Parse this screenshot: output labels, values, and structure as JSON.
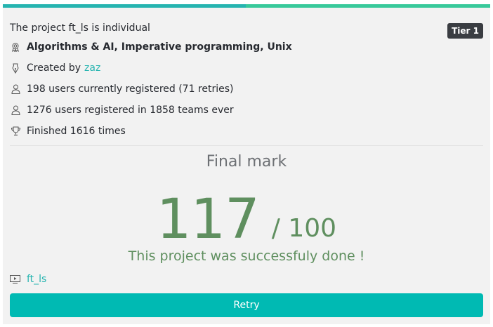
{
  "project": {
    "title": "The project ft_ls is individual",
    "tier": "Tier 1",
    "domains": "Algorithms & AI, Imperative programming, Unix",
    "created_by_label": "Created by",
    "creator": "zaz",
    "current_registrations": "198 users currently registered (71 retries)",
    "total_registrations": "1276 users registered in 1858 teams ever",
    "finished": "Finished 1616 times"
  },
  "result": {
    "final_mark_label": "Final mark",
    "mark": "117",
    "max": "/ 100",
    "status": "This project was successfuly done !"
  },
  "repository": {
    "name": "ft_ls"
  },
  "actions": {
    "retry_label": "Retry"
  },
  "colors": {
    "accent": "#00bab3",
    "progress_left": "#26b4b0",
    "progress_right": "#38c99a",
    "success": "#5f8f5f",
    "badge": "#3a3d42",
    "card_bg": "#f2f2f2"
  },
  "icons": {
    "domains": "medal-icon",
    "creator": "pen-nib-icon",
    "current": "user-icon",
    "total": "user-icon",
    "finished": "trophy-icon",
    "repository": "screen-icon"
  }
}
